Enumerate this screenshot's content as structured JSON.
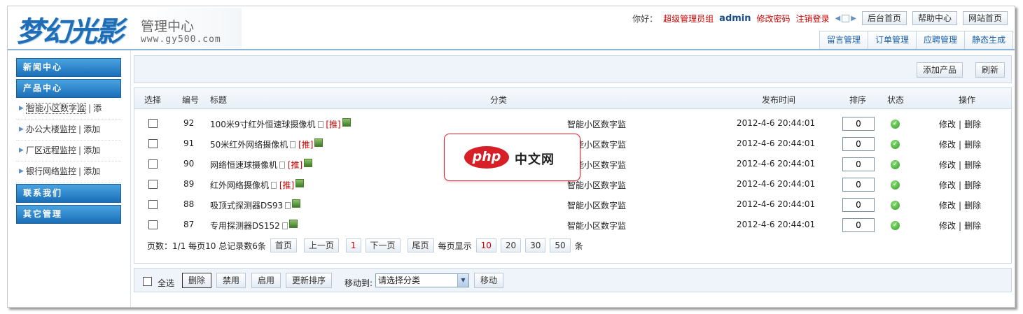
{
  "header": {
    "logo_text": "梦幻光影",
    "title": "管理中心",
    "url": "www.gy500.com",
    "greeting": "你好：",
    "role": "超级管理员组",
    "username": "admin",
    "change_password": "修改密码",
    "logout": "注销登录",
    "top_buttons": [
      "后台首页",
      "帮助中心",
      "网站首页"
    ],
    "tabs": [
      "留言管理",
      "订单管理",
      "应聘管理",
      "静态生成"
    ]
  },
  "sidebar": {
    "news": "新闻中心",
    "products": "产品中心",
    "items": [
      {
        "label": "智能小区数字监",
        "add": "添"
      },
      {
        "label": "办公大楼监控",
        "add": "添加"
      },
      {
        "label": "厂区远程监控",
        "add": "添加"
      },
      {
        "label": "银行网络监控",
        "add": "添加"
      }
    ],
    "contact": "联系我们",
    "other": "其它管理"
  },
  "toolbar": {
    "add_product": "添加产品",
    "refresh": "刷新"
  },
  "table": {
    "headers": {
      "select": "选择",
      "id": "编号",
      "title": "标题",
      "category": "分类",
      "time": "发布时间",
      "sort": "排序",
      "status": "状态",
      "ops": "操作"
    },
    "rec_label": "[推]",
    "edit": "修改",
    "delete": "删除",
    "rows": [
      {
        "id": "92",
        "title": "100米9寸红外恒速球摄像机",
        "category": "智能小区数字监",
        "time": "2012-4-6 20:44:01",
        "sort": "0",
        "rec": true
      },
      {
        "id": "91",
        "title": "50米红外网络摄像机",
        "category": "智能小区数字监",
        "time": "2012-4-6 20:44:01",
        "sort": "0",
        "rec": true
      },
      {
        "id": "90",
        "title": "网络恒速球摄像机",
        "category": "智能小区数字监",
        "time": "2012-4-6 20:44:01",
        "sort": "0",
        "rec": true
      },
      {
        "id": "89",
        "title": "红外网络摄像机",
        "category": "智能小区数字监",
        "time": "2012-4-6 20:44:01",
        "sort": "0",
        "rec": true
      },
      {
        "id": "88",
        "title": "吸顶式探测器DS93",
        "category": "智能小区数字监",
        "time": "2012-4-6 20:44:01",
        "sort": "0",
        "rec": false
      },
      {
        "id": "87",
        "title": "专用探测器DS152",
        "category": "智能小区数字监",
        "time": "2012-4-6 20:44:01",
        "sort": "0",
        "rec": false
      }
    ]
  },
  "pagination": {
    "summary": "页数：1/1 每页10 总记录数6条",
    "first": "首页",
    "prev": "上一页",
    "current": "1",
    "next": "下一页",
    "last": "尾页",
    "per_page_label": "每页显示",
    "sizes": [
      "10",
      "20",
      "30",
      "50"
    ],
    "unit": "条"
  },
  "bottom": {
    "select_all": "全选",
    "delete": "删除",
    "disable": "禁用",
    "enable": "启用",
    "update_sort": "更新排序",
    "move_to": "移动到:",
    "category_select": "请选择分类",
    "move": "移动"
  },
  "watermark": {
    "php": "php",
    "cn": "中文网"
  },
  "colors": {
    "accent_blue": "#1a6fb8",
    "link_red": "#cc0000",
    "status_green": "#2f9a24"
  }
}
